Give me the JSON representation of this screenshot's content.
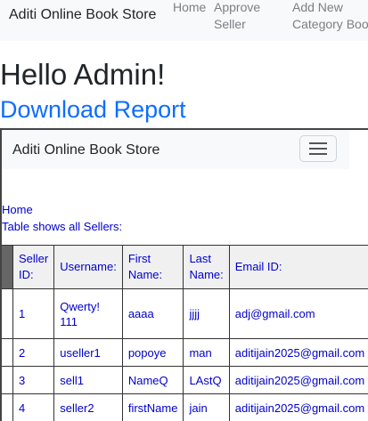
{
  "topnav": {
    "brand": "Aditi Online Book Store",
    "links": [
      "Home",
      "Approve Seller",
      "Add New Category Book"
    ]
  },
  "greeting": "Hello Admin!",
  "download_link": "Download Report",
  "frame": {
    "brand": "Aditi Online Book Store",
    "home_link": "Home",
    "caption": "Table shows all Sellers:"
  },
  "table": {
    "headers": [
      "Seller ID:",
      "Username:",
      "First Name:",
      "Last Name:",
      "Email ID:"
    ],
    "rows": [
      [
        "1",
        "Qwerty! 111",
        "aaaa",
        "jjjj",
        "adj@gmail.com"
      ],
      [
        "2",
        "useller1",
        "popoye",
        "man",
        "aditijain2025@gmail.com"
      ],
      [
        "3",
        "sell1",
        "NameQ",
        "LAstQ",
        "aditijain2025@gmail.com"
      ],
      [
        "4",
        "seller2",
        "firstName",
        "jain",
        "aditijain2025@gmail.com"
      ]
    ]
  },
  "colors": {
    "link": "#0d6efd",
    "navbar_bg": "#f8f9fa",
    "table_text": "#0000cc"
  }
}
